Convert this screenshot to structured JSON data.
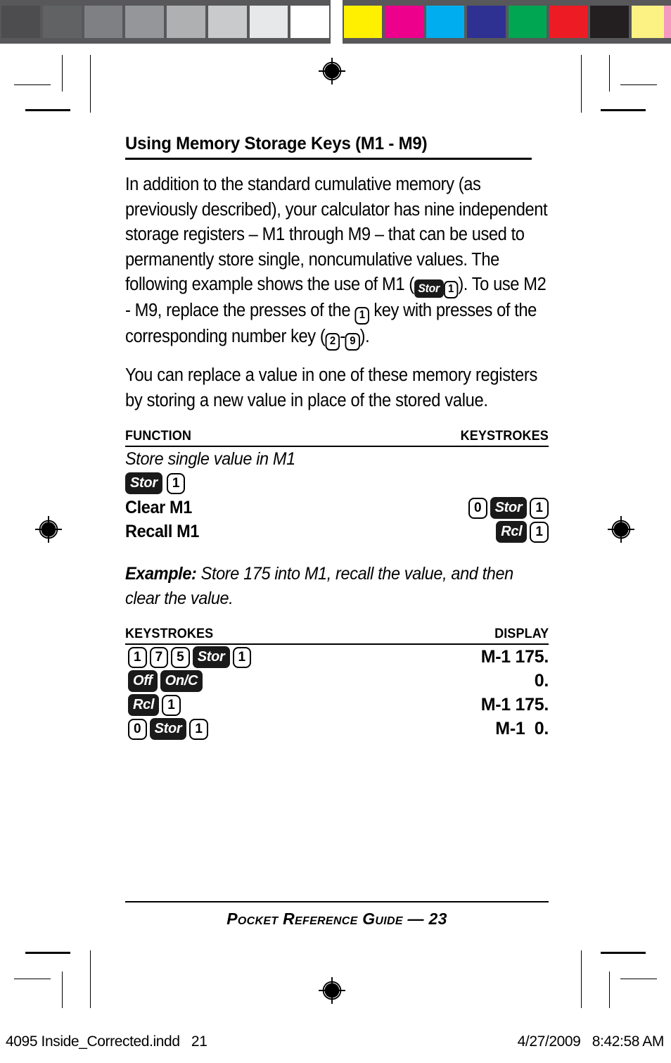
{
  "prepress": {
    "gray_swatches": [
      "#4d4d4f",
      "#616264",
      "#7f8083",
      "#949699",
      "#aeb0b2",
      "#c9cacc",
      "#e7e8e9",
      "#ffffff"
    ],
    "color_swatches": [
      "#fff000",
      "#ec008c",
      "#00aeef",
      "#2e3192",
      "#00a651",
      "#ed1c24",
      "#231f20",
      "#fbf283"
    ],
    "edge_strip_color": "#f49ac1",
    "bar_background": "#58585a",
    "registration_mark": "registration-target"
  },
  "page": {
    "title": "Using Memory Storage Keys (M1 - M9)",
    "paragraph1": {
      "part1": "In addition to the standard cumulative memory (as previously described), your calculator has nine independent storage registers – M1 through M9 – that can be used to permanently store single, noncumulative values. The following example shows the use of M1 (",
      "key_stor": "Stor",
      "key_1": "1",
      "part2": "). To use M2 - M9, replace the presses of the ",
      "key_1b": "1",
      "part3": " key with presses of the corresponding number key (",
      "key_2": "2",
      "dash": "-",
      "key_9": "9",
      "part4": ")."
    },
    "paragraph2": "You can replace a value in one of these memory registers by storing a new value in place of the stored value.",
    "function_table": {
      "header_left": "FUNCTION",
      "header_right": "KEYSTROKES",
      "rows": [
        {
          "label": "Store single value in M1",
          "style": "italic",
          "keys_below": [
            "Stor",
            "1"
          ],
          "keys_right": []
        },
        {
          "label": "Clear M1",
          "style": "bold",
          "keys_below": [],
          "keys_right": [
            "0",
            "Stor",
            "1"
          ]
        },
        {
          "label": "Recall M1",
          "style": "bold",
          "keys_below": [],
          "keys_right": [
            "Rcl",
            "1"
          ]
        }
      ]
    },
    "example": {
      "lead": "Example:",
      "text": " Store 175 into M1, recall the value, and then clear the value."
    },
    "keystroke_table": {
      "header_left": "KEYSTROKES",
      "header_right": "DISPLAY",
      "rows": [
        {
          "keys": [
            "1",
            "7",
            "5",
            "Stor",
            "1"
          ],
          "display": "M-1 175."
        },
        {
          "keys": [
            "Off",
            "On/C"
          ],
          "display": "0."
        },
        {
          "keys": [
            "Rcl",
            "1"
          ],
          "display": "M-1 175."
        },
        {
          "keys": [
            "0",
            "Stor",
            "1"
          ],
          "display": "M-1  0."
        }
      ]
    },
    "footer": "Pocket Reference Guide — 23"
  },
  "slug": {
    "left": "4095 Inside_Corrected.indd   21",
    "right": "4/27/2009   8:42:58 AM"
  }
}
